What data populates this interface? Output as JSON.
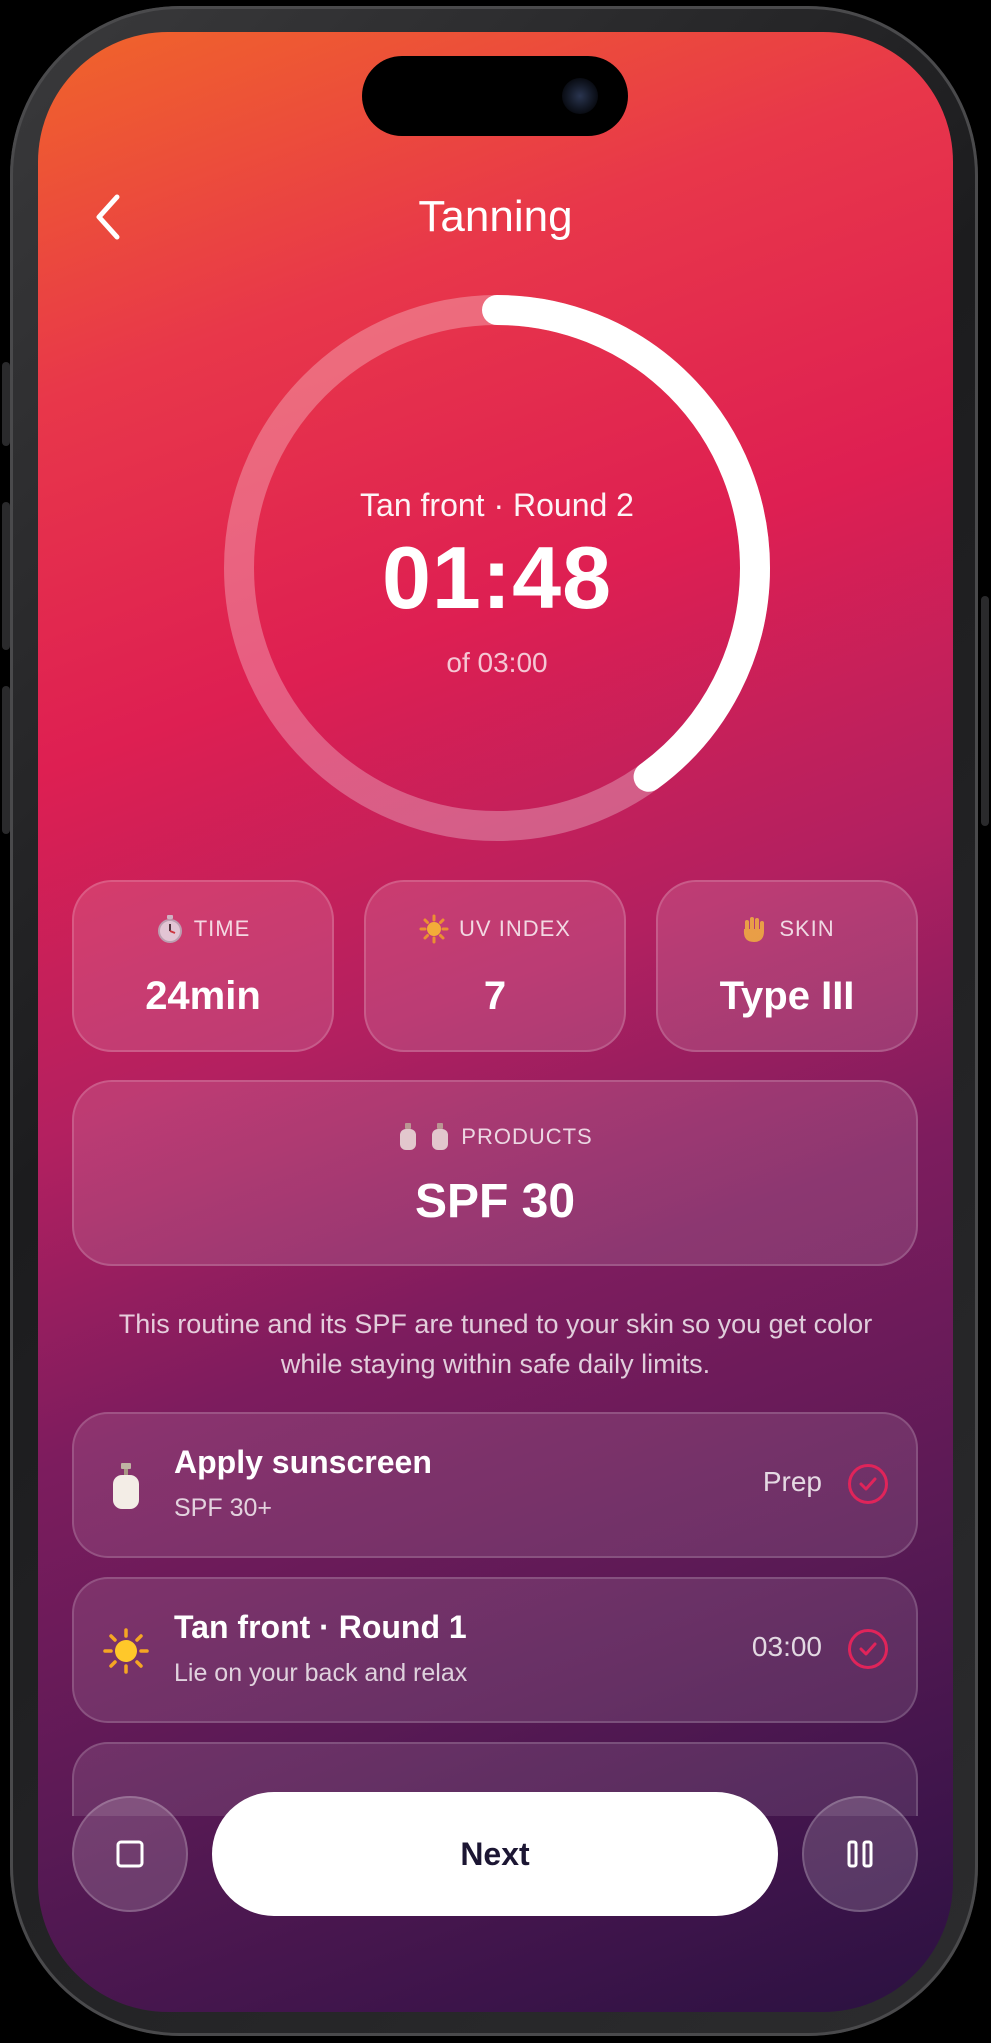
{
  "header": {
    "title": "Tanning",
    "back_icon": "chevron-left-icon"
  },
  "timer": {
    "label": "Tan front · Round 2",
    "elapsed": "01:48",
    "total": "of 03:00",
    "progress_fraction": 0.4,
    "track_color": "rgba(255,255,255,0.28)",
    "progress_color": "#ffffff"
  },
  "stats": [
    {
      "icon": "stopwatch-icon",
      "label": "TIME",
      "value": "24min"
    },
    {
      "icon": "sun-icon",
      "label": "UV INDEX",
      "value": "7"
    },
    {
      "icon": "hand-icon",
      "label": "SKIN",
      "value": "Type III"
    }
  ],
  "products": {
    "icons": [
      "lotion-bottle-icon",
      "lotion-bottle-icon"
    ],
    "label": "PRODUCTS",
    "value": "SPF 30"
  },
  "info_text": "This routine and its SPF are tuned to your skin so you get color while staying within safe daily limits.",
  "steps": [
    {
      "icon": "lotion-bottle-icon",
      "title": "Apply sunscreen",
      "subtitle": "SPF 30+",
      "meta": "Prep",
      "done": true
    },
    {
      "icon": "sun-icon",
      "title": "Tan front · Round 1",
      "subtitle": "Lie on your back and relax",
      "meta": "03:00",
      "done": true
    }
  ],
  "controls": {
    "stop_icon": "stop-icon",
    "next_label": "Next",
    "pause_icon": "pause-icon"
  },
  "colors": {
    "accent": "#e0245a",
    "button_text": "#1c1633"
  }
}
